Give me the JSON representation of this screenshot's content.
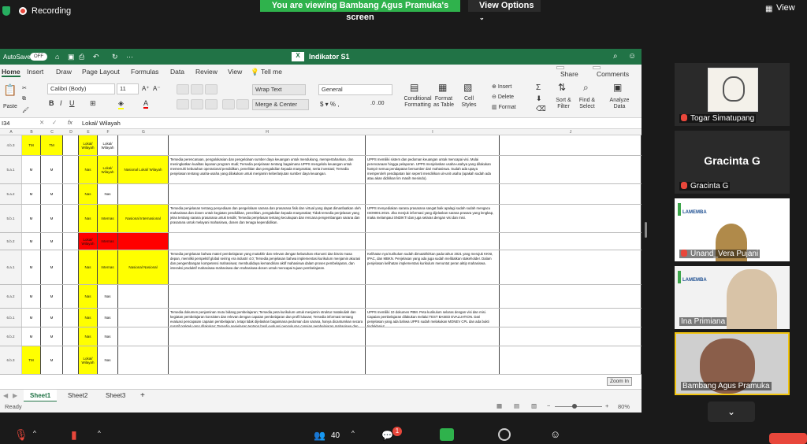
{
  "topbar": {
    "recording": "Recording",
    "viewing": "You are viewing Bambang Agus Pramuka's screen",
    "view_options": "View Options",
    "view": "View"
  },
  "excel": {
    "autosave": "AutoSave",
    "autosave_state": "OFF",
    "title": "Indikator S1",
    "tabs": [
      "Home",
      "Insert",
      "Draw",
      "Page Layout",
      "Formulas",
      "Data",
      "Review",
      "View",
      "Tell me"
    ],
    "share": "Share",
    "comments": "Comments",
    "font": "Calibri (Body)",
    "size": "11",
    "wrap": "Wrap Text",
    "merge": "Merge & Center",
    "format": "General",
    "paste": "Paste",
    "cond": "Conditional Formatting",
    "fmt_table": "Format as Table",
    "cell_styles": "Cell Styles",
    "insert": "Insert",
    "delete": "Delete",
    "format_btn": "Format",
    "sort": "Sort & Filter",
    "find": "Find & Select",
    "analyze": "Analyze Data",
    "cellref": "I34",
    "formula": "Lokal/ Wilayah",
    "columns": [
      "A",
      "B",
      "C",
      "D",
      "E",
      "F",
      "G",
      "H",
      "I",
      "J",
      "K"
    ],
    "rows": [
      {
        "id": "4.b.3",
        "b": "TM",
        "c": "TM",
        "f": "Lokal/ Wilayah",
        "g": "Lokal/ Wilayah",
        "h": "",
        "i": "",
        "j": ""
      },
      {
        "id": "5.a.1",
        "b": "M",
        "c": "M",
        "f": "Nas",
        "g": "Lokal/ Wilayah",
        "h": "Nasional Lokal/ Wilayah",
        "i": "Tersedia perencanaan, pengalokasian dan pengelolaan sumber daya keuangan untuk mendukung, mempertahankan, dan meningkatkan kualitas layanan program studi; Tersedia penjelasan tentang bagaimana UPPS mengelola keuangan untuk memenuhi kebutuhan operasional pendidikan, penelitian dan pengabdian kepada masyarakat, serta investasi; Tersedia penjelasan tentang usaha-usaha yang dilakukan untuk menjamin keberlanjutan sumber daya keuangan.",
        "j": "UPPS memiliki sistem dan pedoman keuangan untuk mencapai visi. Mulai perencanaan hingga pelaporan. UPPS menjelaskan usaha-usahya yang dilakukan hampir semua pendapatan bersumber dari mahasiswa. Sudah ada upaya memperoleh pendapatan lain seperti mendirikan uit-unit usaha (apakah sudah ada atau akan didirikan lim masih menindo)."
      },
      {
        "id": "5.a.2",
        "b": "M",
        "c": "M",
        "f": "Nas",
        "g": "Nas",
        "h": "",
        "i": "",
        "j": ""
      },
      {
        "id": "5.b.1",
        "b": "M",
        "c": "M",
        "f": "Nas",
        "g": "Internas",
        "h": "Nasional Internasional",
        "i": "Tersedia penjelasan tentang penyediaan dan pengelolaan sarana dan prasarana fisik dan virtual yang dapat dimanfaatkan oleh mahasiswa dan dosen untuk kegiatan pendidikan, penelitian, pengabdian kepada masyarakat; Tidak tersedia penjelasan yang jelas tentang sarana prasarana untuk tendik; Tersedia penjelasan tentang kecukupan dan rencana pengembangan sarana dan prasarana untuk melayani mahasiswa, dosen dan tenaga kependidikan.",
        "j": "UPPS menyediakan sarana prasarana sangat baik apalagi sudah sudah mengacu ISO9001:2015. Jika menjuk informasi yang dijelaskan sarana prasara yang lengkap, maka melampaui SNDIKTI dan juga selaras dengan visi dan misi."
      },
      {
        "id": "5.b.2",
        "b": "M",
        "c": "M",
        "f": "Lokal/ Wilayah",
        "g": "Internas",
        "h": "",
        "i": "",
        "j": ""
      },
      {
        "id": "6.a.1",
        "b": "M",
        "c": "M",
        "f": "Nas",
        "g": "Internas",
        "h": "Nasional Nasional",
        "i": "Tersedia penjelasan bahwa materi pembelajaran yang mutakhir dan relevan dengan kebutuhan ekonomi dan bisnis masa depan, memiliki perspektif global seiring era industri 4.0; Tersedia penjelasan bahwa implementasi kurikulum menjamin akurasi dan pengembangan kompetensi mahasiswa; membudidaya kemandirian aktif mahasiswa dalam proses pembelajaran, dan interaksi produktif mahasiswa-mahasiswa dan mahasiswa-dosen untuk mencapai tujuan pembelajaran.",
        "j": "Kelihatan nya kurikulum sudah dimutakhirkan pada tahun 2021 yang merujuk KKNI, IPAC, dan MBKN. Penjelasan yang ada juga sudah melibatkan stakeholder. Dalam penjelasan kelihatan implementasi kurikulum menuntut peran aktip mahasiswa."
      },
      {
        "id": "6.a.2",
        "b": "M",
        "c": "M",
        "f": "Nas",
        "g": "Nas",
        "h": "",
        "i": "",
        "j": ""
      },
      {
        "id": "6.b.1",
        "b": "M",
        "c": "M",
        "f": "Nas",
        "g": "Nas",
        "h": "",
        "i": "Tersedia dokumen penjaminan mutu bidang pembelajaran; Tersedia peta kurikulum untuk menjamin struktur matakuliah dan kegiatan pembelajaran konsisten dan relevan dengan capaian pembelajaran dan profil lulusan; Tersedia informasi tentang evaluasi pencapaian capaian pembelajaran, tetapi tidak dijelaskan bagaimana pedoman dan sarana, hanya dicantumkan secara naratif praktek yang dilakukan; Tersedia penjelasan tentang hasil evaluasi pengukuran capaian pembelajaran mahasiswa dan tindak lanjut yang ditetapkan.",
        "j": "UPPS memiliki 10 dokumen PBM. Peta kurikulum selaras dengan visi dan misi. Capaian pembelajaran dilakukan melalui TEST BASED EVALUATION. Dari penjelasan yang ada bahwa UPPS sudah melakukan MONEV CPL dan ada bukti tindaklanjut."
      },
      {
        "id": "6.b.2",
        "b": "M",
        "c": "M",
        "f": "Nas",
        "g": "Nas",
        "h": "",
        "i": "",
        "j": ""
      },
      {
        "id": "6.b.3",
        "b": "TM",
        "c": "M",
        "f": "Lokal/ Wilayah",
        "g": "Nas",
        "h": "",
        "i": "",
        "j": ""
      }
    ],
    "sheets": [
      "Sheet1",
      "Sheet2",
      "Sheet3"
    ],
    "zoom_in": "Zoom In",
    "status": "Ready",
    "zoom": "80%"
  },
  "participants": [
    {
      "name": "Togar Simatupang"
    },
    {
      "name": "Gracinta G",
      "title": "Gracinta G"
    },
    {
      "name": "Unand_Vera Pujani",
      "logo": "LAMEMBA"
    },
    {
      "name": "Ina Primiana",
      "logo": "LAMEMBA"
    },
    {
      "name": "Bambang Agus Pramuka"
    }
  ],
  "bottom": {
    "participants_count": "40",
    "chat_badge": "1"
  }
}
